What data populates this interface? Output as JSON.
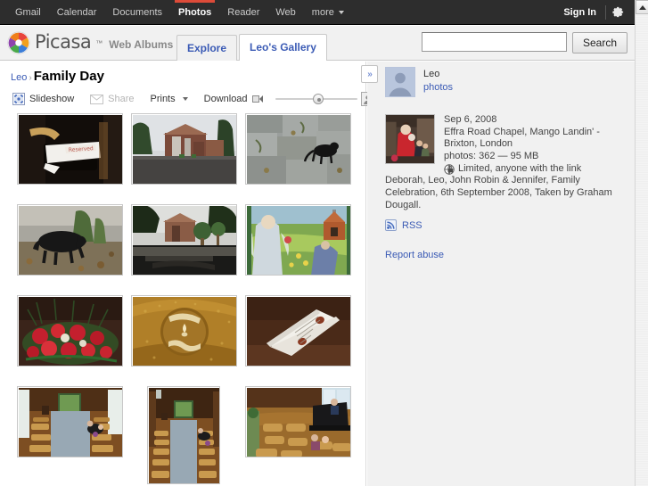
{
  "gbar": {
    "items": [
      {
        "label": "Gmail",
        "active": false
      },
      {
        "label": "Calendar",
        "active": false
      },
      {
        "label": "Documents",
        "active": false
      },
      {
        "label": "Photos",
        "active": true
      },
      {
        "label": "Reader",
        "active": false
      },
      {
        "label": "Web",
        "active": false
      }
    ],
    "more_label": "more",
    "signin_label": "Sign In",
    "gear_icon": "gear-icon"
  },
  "header": {
    "logo_text": "Picasa",
    "logo_tm": "™",
    "logo_sub": "Web Albums",
    "logo_icon": "picasa-pinwheel-icon",
    "tabs": [
      {
        "label": "Explore",
        "active": false
      },
      {
        "label": "Leo's Gallery",
        "active": true
      }
    ],
    "search": {
      "value": "",
      "placeholder": "",
      "button_label": "Search"
    }
  },
  "breadcrumb": {
    "owner": "Leo",
    "separator": "›",
    "current": "Family Day"
  },
  "toolbar": {
    "slideshow_label": "Slideshow",
    "slideshow_icon": "slideshow-icon",
    "share_label": "Share",
    "share_icon": "envelope-icon",
    "prints_label": "Prints",
    "download_label": "Download",
    "download_icon": "download-icon",
    "zoom_small_icon": "small-thumbnail-icon",
    "zoom_large_icon": "large-thumbnail-icon",
    "zoom_value": 50
  },
  "photos": [
    {
      "alt": "reserved-sign-on-chair",
      "orient": "land"
    },
    {
      "alt": "brick-chapel-exterior",
      "orient": "land"
    },
    {
      "alt": "black-cat-on-paving-stones",
      "orient": "land"
    },
    {
      "alt": "black-dog-in-garden",
      "orient": "land"
    },
    {
      "alt": "chapel-garden-with-topiary",
      "orient": "land"
    },
    {
      "alt": "colourful-mural-painting",
      "orient": "land"
    },
    {
      "alt": "red-carnation-flower-arrangement",
      "orient": "land"
    },
    {
      "alt": "golden-chalice-emblem",
      "orient": "land"
    },
    {
      "alt": "order-of-service-booklet",
      "orient": "land"
    },
    {
      "alt": "chapel-interior-pews-left",
      "orient": "land"
    },
    {
      "alt": "chapel-interior-aisle-portrait",
      "orient": "port"
    },
    {
      "alt": "chapel-interior-with-piano",
      "orient": "land"
    }
  ],
  "sidebar": {
    "collapse_label": "»",
    "owner": {
      "name": "Leo",
      "link_label": "photos",
      "avatar_icon": "user-avatar"
    },
    "album": {
      "cover_alt": "family-group-photo-red-dress",
      "date": "Sep 6, 2008",
      "location": "Effra Road Chapel, Mango Landin' - Brixton, London",
      "stats": "photos: 362 — 95 MB",
      "privacy": "Limited, anyone with the link",
      "privacy_icon": "globe-lock-icon"
    },
    "description": "Deborah, Leo, John Robin & Jennifer, Family Celebration, 6th September 2008, Taken by Graham Dougall.",
    "rss_label": "RSS",
    "rss_icon": "rss-icon",
    "report_label": "Report abuse"
  },
  "scrollbar": {
    "up_icon": "scroll-up-arrow"
  },
  "colors": {
    "accent_blue": "#3b5bb5",
    "gbar_bg": "#2d2d2d",
    "active_red": "#dd4b39",
    "header_bg": "#f1f1f1",
    "sidebar_bg": "#f1f1f1"
  }
}
